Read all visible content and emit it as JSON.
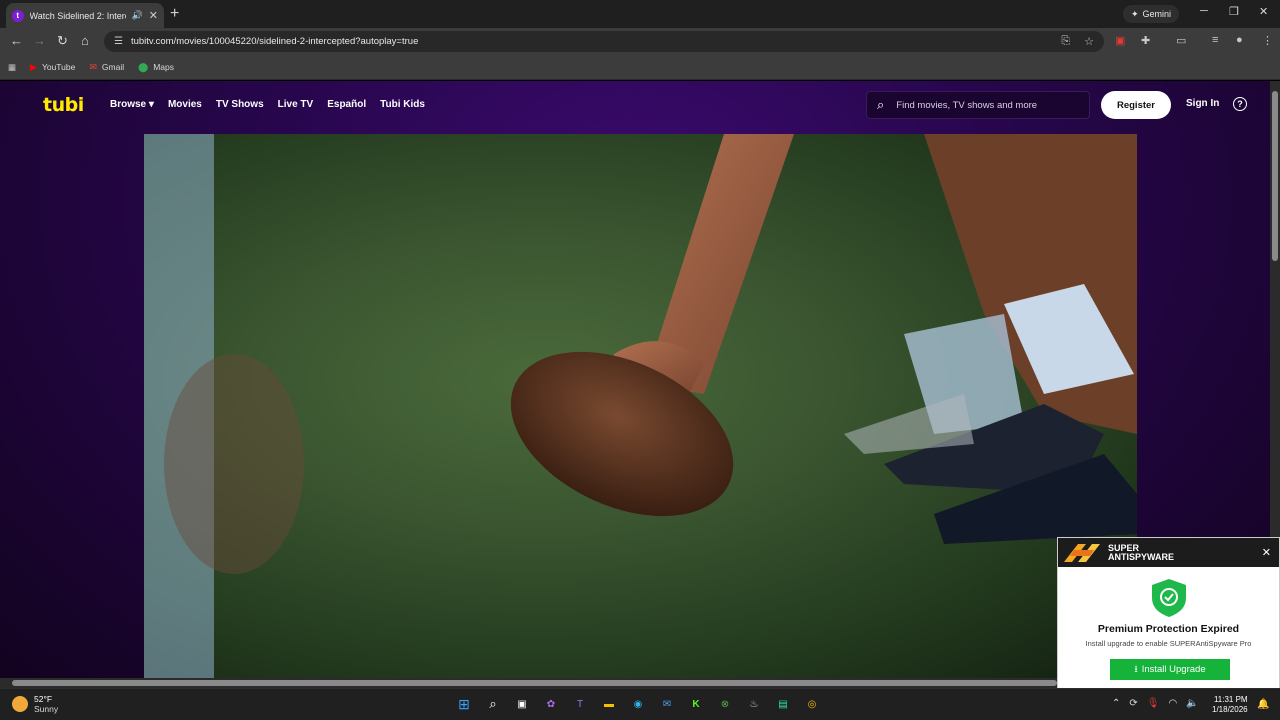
{
  "browser": {
    "tab_title": "Watch Sidelined 2: Intercep",
    "favicon_letter": "t",
    "new_tab": "+",
    "gemini_label": "Gemini",
    "url": "tubitv.com/movies/100045220/sidelined-2-intercepted?autoplay=true",
    "bookmarks": [
      {
        "label": "YouTube",
        "icon": "youtube-icon"
      },
      {
        "label": "Gmail",
        "icon": "gmail-icon"
      },
      {
        "label": "Maps",
        "icon": "maps-icon"
      }
    ]
  },
  "tubi": {
    "logo": "tubi",
    "nav": [
      "Browse",
      "Movies",
      "TV Shows",
      "Live TV",
      "Español",
      "Tubi Kids"
    ],
    "search_placeholder": "Find movies, TV shows and more",
    "register": "Register",
    "sign_in": "Sign In",
    "help": "?"
  },
  "popup": {
    "brand_line1": "SUPER",
    "brand_line2": "ANTISPYWARE",
    "title": "Premium Protection Expired",
    "subtitle": "Install upgrade to enable SUPERAntiSpyware Pro",
    "button": "Install Upgrade"
  },
  "taskbar": {
    "temperature": "52°F",
    "condition": "Sunny",
    "time": "11:31 PM",
    "date": "1/18/2026"
  },
  "colors": {
    "tubi_yellow": "#ffea00",
    "page_purple": "#26064a",
    "install_green": "#15b33a"
  }
}
